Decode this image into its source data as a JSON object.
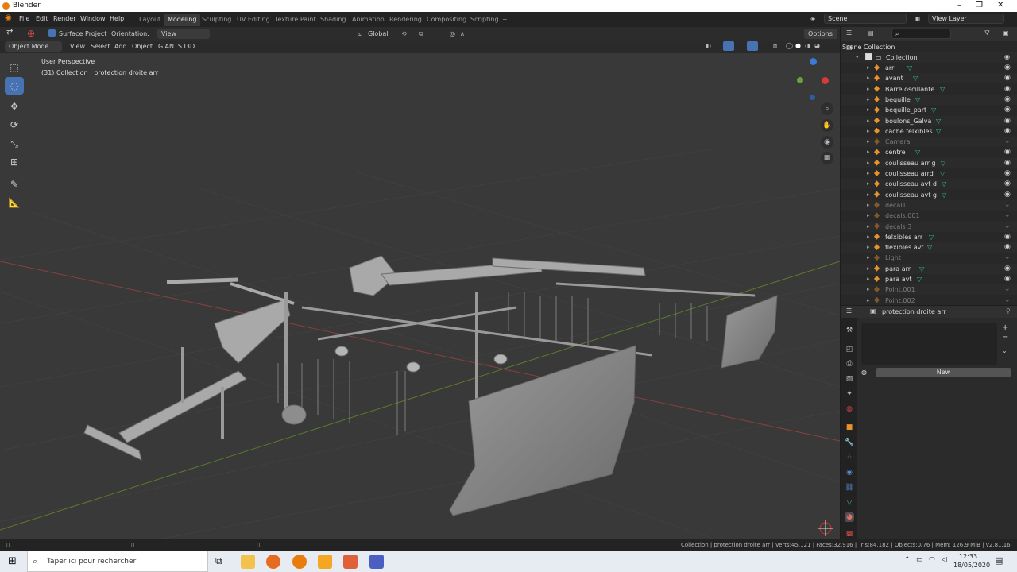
{
  "window": {
    "title": "Blender",
    "controls": [
      "–",
      "❐",
      "✕"
    ]
  },
  "menu": [
    "File",
    "Edit",
    "Render",
    "Window",
    "Help"
  ],
  "workspaces": [
    "Layout",
    "Modeling",
    "Sculpting",
    "UV Editing",
    "Texture Paint",
    "Shading",
    "Animation",
    "Rendering",
    "Compositing",
    "Scripting",
    "+"
  ],
  "active_workspace": "Modeling",
  "scene": {
    "name": "Scene",
    "view_layer": "View Layer"
  },
  "tool_header": {
    "surface_project": "Surface Project",
    "orientation_label": "Orientation:",
    "orientation_value": "View",
    "transform_orientation": "Global",
    "options": "Options"
  },
  "view_header": {
    "mode": "Object Mode",
    "menus": [
      "View",
      "Select",
      "Add",
      "Object",
      "GIANTS I3D"
    ]
  },
  "viewport": {
    "perspective": "User Perspective",
    "collection_info": "(31) Collection | protection droite arr"
  },
  "outliner": {
    "search_placeholder": "",
    "scene_collection": "Scene Collection",
    "collection": "Collection",
    "items": [
      {
        "name": "arr",
        "dim": false
      },
      {
        "name": "avant",
        "dim": false
      },
      {
        "name": "Barre oscillante",
        "dim": false
      },
      {
        "name": "bequille",
        "dim": false
      },
      {
        "name": "bequille_part",
        "dim": false
      },
      {
        "name": "boulons_Galva",
        "dim": false
      },
      {
        "name": "cache felxibles",
        "dim": false
      },
      {
        "name": "Camera",
        "dim": true
      },
      {
        "name": "centre",
        "dim": false
      },
      {
        "name": "coulisseau arr g",
        "dim": false
      },
      {
        "name": "coulisseau arrd",
        "dim": false
      },
      {
        "name": "coulisseau avt d",
        "dim": false
      },
      {
        "name": "coulisseau avt g",
        "dim": false
      },
      {
        "name": "decal1",
        "dim": true
      },
      {
        "name": "decals.001",
        "dim": true
      },
      {
        "name": "decals 3",
        "dim": true
      },
      {
        "name": "felxibles arr",
        "dim": false
      },
      {
        "name": "flexibles avt",
        "dim": false
      },
      {
        "name": "Light",
        "dim": true
      },
      {
        "name": "para arr",
        "dim": false
      },
      {
        "name": "para avt",
        "dim": false
      },
      {
        "name": "Point.001",
        "dim": true
      },
      {
        "name": "Point.002",
        "dim": true
      }
    ]
  },
  "properties": {
    "object_name": "protection droite arr",
    "new_button": "New"
  },
  "status": {
    "text": "Collection | protection droite arr | Verts:45,121 | Faces:32,916 | Tris:84,182 | Objects:0/76 | Mem: 126.9 MiB | v2.81.16"
  },
  "taskbar": {
    "search_placeholder": "Taper ici pour rechercher",
    "time": "12:33",
    "date": "18/05/2020"
  },
  "colors": {
    "accent": "#4772b3",
    "object_orange": "#e8922b",
    "mesh_green": "#33c17f",
    "grid": "#393939"
  }
}
